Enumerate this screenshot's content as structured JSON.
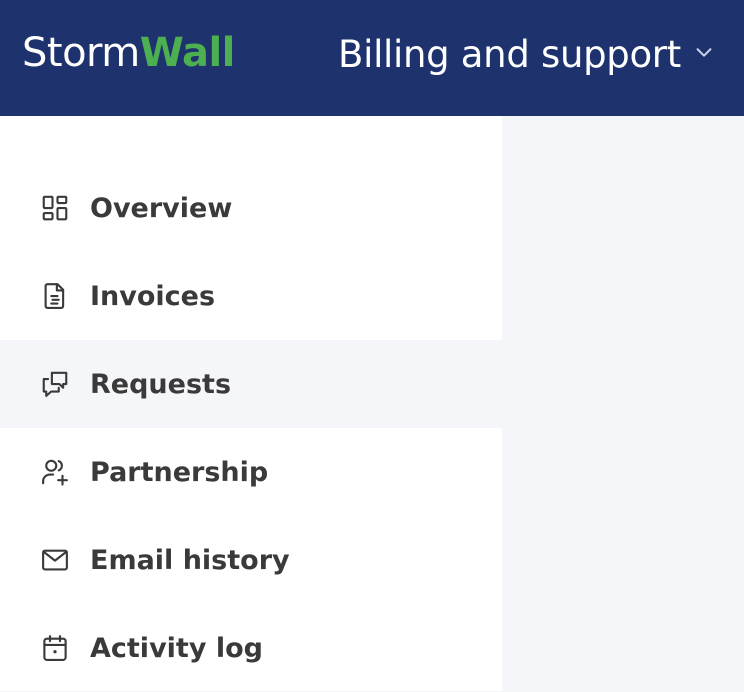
{
  "brand": {
    "logo_part1": "Storm",
    "logo_part2": "Wall",
    "accent_color": "#4caf50",
    "header_color": "#1e336d"
  },
  "header": {
    "app_title": "Billing and support",
    "switcher_icon": "chevron-down-icon"
  },
  "sidebar": {
    "active_item": "Requests",
    "items": [
      {
        "label": "Overview",
        "icon": "dashboard-grid-icon"
      },
      {
        "label": "Invoices",
        "icon": "document-icon"
      },
      {
        "label": "Requests",
        "icon": "chat-bubbles-icon"
      },
      {
        "label": "Partnership",
        "icon": "user-plus-icon"
      },
      {
        "label": "Email history",
        "icon": "envelope-icon"
      },
      {
        "label": "Activity log",
        "icon": "calendar-icon"
      }
    ]
  }
}
